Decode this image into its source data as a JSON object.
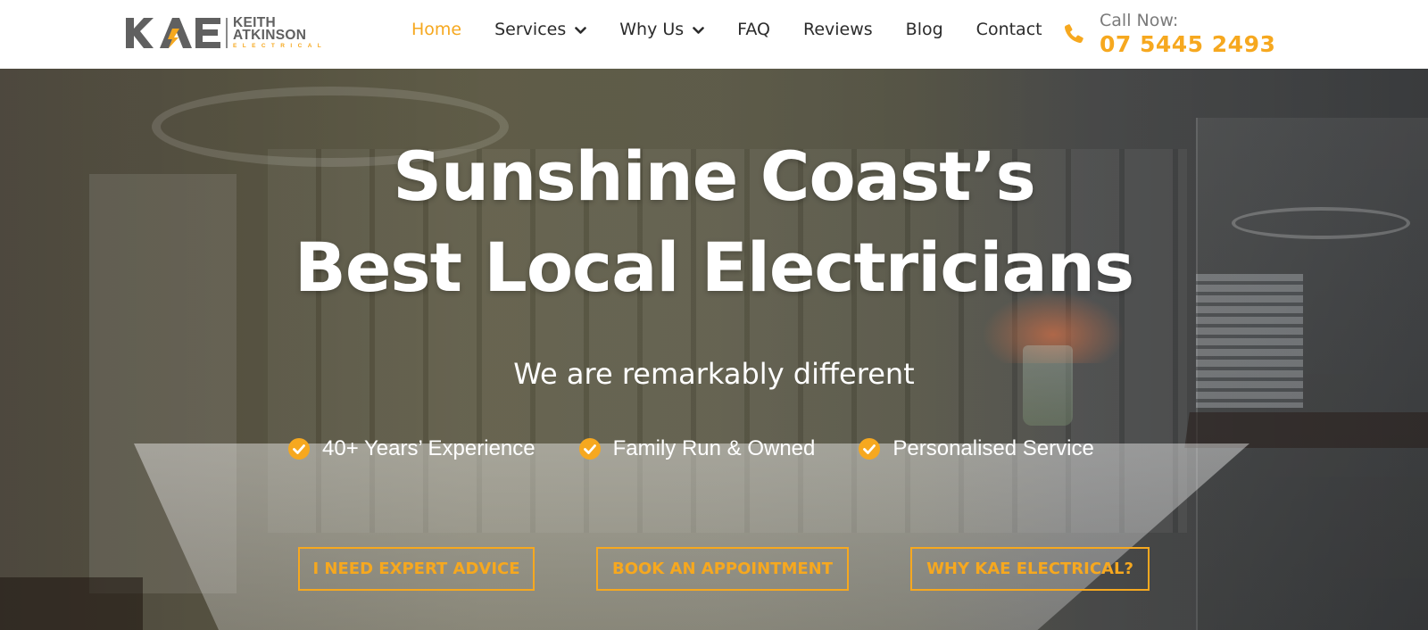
{
  "brand": {
    "logo_mark": "KAE",
    "name_line1": "KEITH",
    "name_line2": "ATKINSON",
    "name_line3": "ELECTRICAL",
    "accent_color": "#f6a81f",
    "text_color": "#606060"
  },
  "nav": {
    "items": [
      {
        "label": "Home",
        "active": true,
        "has_dropdown": false
      },
      {
        "label": "Services",
        "active": false,
        "has_dropdown": true
      },
      {
        "label": "Why Us",
        "active": false,
        "has_dropdown": true
      },
      {
        "label": "FAQ",
        "active": false,
        "has_dropdown": false
      },
      {
        "label": "Reviews",
        "active": false,
        "has_dropdown": false
      },
      {
        "label": "Blog",
        "active": false,
        "has_dropdown": false
      },
      {
        "label": "Contact",
        "active": false,
        "has_dropdown": false
      }
    ]
  },
  "call": {
    "icon": "phone-icon",
    "label": "Call Now:",
    "number": "07 5445 2493"
  },
  "hero": {
    "title_line1": "Sunshine Coast’s",
    "title_line2": "Best Local Electricians",
    "subtitle": "We are remarkably different",
    "features": [
      {
        "icon": "check-circle-icon",
        "label": "40+ Years’ Experience"
      },
      {
        "icon": "check-circle-icon",
        "label": "Family Run & Owned"
      },
      {
        "icon": "check-circle-icon",
        "label": "Personalised Service"
      }
    ],
    "buttons": [
      {
        "label": "I NEED EXPERT ADVICE"
      },
      {
        "label": "BOOK AN APPOINTMENT"
      },
      {
        "label": "WHY KAE ELECTRICAL?"
      }
    ]
  }
}
